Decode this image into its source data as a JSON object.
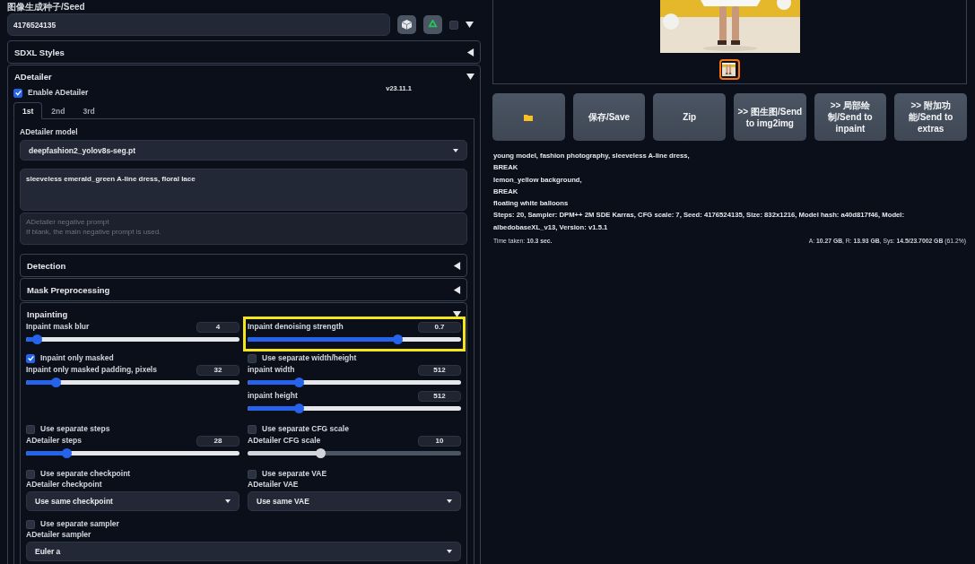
{
  "seed": {
    "label": "图像生成种子/Seed",
    "value": "4176524135",
    "extra_checked": false
  },
  "sdxl_styles": {
    "title": "SDXL Styles",
    "expanded": false
  },
  "adetailer": {
    "title": "ADetailer",
    "expanded": true,
    "enable": {
      "label": "Enable ADetailer",
      "checked": true
    },
    "version": "v23.11.1",
    "tabs": [
      {
        "label": "1st",
        "selected": true
      },
      {
        "label": "2nd",
        "selected": false
      },
      {
        "label": "3rd",
        "selected": false
      }
    ],
    "model": {
      "label": "ADetailer model",
      "value": "deepfashion2_yolov8s-seg.pt"
    },
    "prompt": {
      "value": "sleeveless emerald_green A-line dress, floral lace"
    },
    "negative_prompt": {
      "placeholder": "ADetailer negative prompt\nIf blank, the main negative prompt is used."
    },
    "sections": [
      {
        "title": "Detection",
        "expanded": false
      },
      {
        "title": "Mask Preprocessing",
        "expanded": false
      }
    ],
    "inpainting": {
      "title": "Inpainting",
      "expanded": true,
      "rows": [
        {
          "cells": [
            {
              "kind": "slider",
              "label": "Inpaint mask blur",
              "value": "4",
              "level": 0.05,
              "disabled": false,
              "highlighted": false
            },
            {
              "kind": "slider",
              "label": "Inpaint denoising strength",
              "value": "0.7",
              "level": 0.7,
              "disabled": false,
              "highlighted": true
            }
          ]
        },
        {
          "cells": [
            {
              "kind": "checkbox",
              "label": "Inpaint only masked",
              "checked": true
            },
            {
              "kind": "checkbox",
              "label": "Use separate width/height",
              "checked": false
            }
          ]
        },
        {
          "cells": [
            {
              "kind": "slider",
              "label": "Inpaint only masked padding, pixels",
              "value": "32",
              "level": 0.14,
              "disabled": false,
              "highlighted": false
            },
            {
              "kind": "slider",
              "label": "inpaint width",
              "value": "512",
              "level": 0.24,
              "disabled": false,
              "highlighted": false
            }
          ]
        },
        {
          "cells": [
            {
              "kind": "empty"
            },
            {
              "kind": "slider",
              "label": "inpaint height",
              "value": "512",
              "level": 0.24,
              "disabled": false,
              "highlighted": false
            }
          ]
        },
        {
          "cells": [
            {
              "kind": "checkbox",
              "label": "Use separate steps",
              "checked": false
            },
            {
              "kind": "checkbox",
              "label": "Use separate CFG scale",
              "checked": false
            }
          ]
        },
        {
          "cells": [
            {
              "kind": "slider",
              "label": "ADetailer steps",
              "value": "28",
              "level": 0.19,
              "disabled": false,
              "highlighted": false
            },
            {
              "kind": "slider",
              "label": "ADetailer CFG scale",
              "value": "10",
              "level": 0.34,
              "disabled": true,
              "highlighted": false
            }
          ]
        },
        {
          "cells": [
            {
              "kind": "checkbox",
              "label": "Use separate checkpoint",
              "checked": false
            },
            {
              "kind": "checkbox",
              "label": "Use separate VAE",
              "checked": false
            }
          ]
        },
        {
          "cells": [
            {
              "kind": "dropdown",
              "label": "ADetailer checkpoint",
              "value": "Use same checkpoint"
            },
            {
              "kind": "dropdown",
              "label": "ADetailer VAE",
              "value": "Use same VAE"
            }
          ]
        },
        {
          "cells": [
            {
              "kind": "checkbox",
              "label": "Use separate sampler",
              "checked": false
            }
          ]
        },
        {
          "cells": [
            {
              "kind": "dropdown",
              "label": "ADetailer sampler",
              "value": "Euler a"
            }
          ]
        }
      ]
    }
  },
  "gallery": {
    "thumbnails": [
      {
        "kind": "picture",
        "selected": true
      }
    ]
  },
  "actions": [
    {
      "kind": "folder"
    },
    {
      "kind": "text",
      "label": "保存/Save"
    },
    {
      "kind": "text",
      "label": "Zip"
    },
    {
      "kind": "text",
      "label": ">> 图生图/Send to img2img"
    },
    {
      "kind": "text",
      "label": ">> 局部绘制/Send to inpaint"
    },
    {
      "kind": "text",
      "label": ">> 附加功能/Send to extras"
    }
  ],
  "info": {
    "lines": [
      "young model, fashion photography, sleeveless A-line dress,",
      "BREAK",
      "lemon_yellow background,",
      "BREAK",
      "floating white balloons",
      "Steps: 20, Sampler: DPM++ 2M SDE Karras, CFG scale: 7, Seed: 4176524135, Size: 832x1216, Model hash: a40d817f46, Model: albedobaseXL_v13, Version: v1.5.1"
    ],
    "time": "Time taken: **10.3 sec.**",
    "memory": "A: **10.27 GB**, R: **13.93 GB**, Sys: **14.5/23.7002 GB** (61.2%)"
  }
}
